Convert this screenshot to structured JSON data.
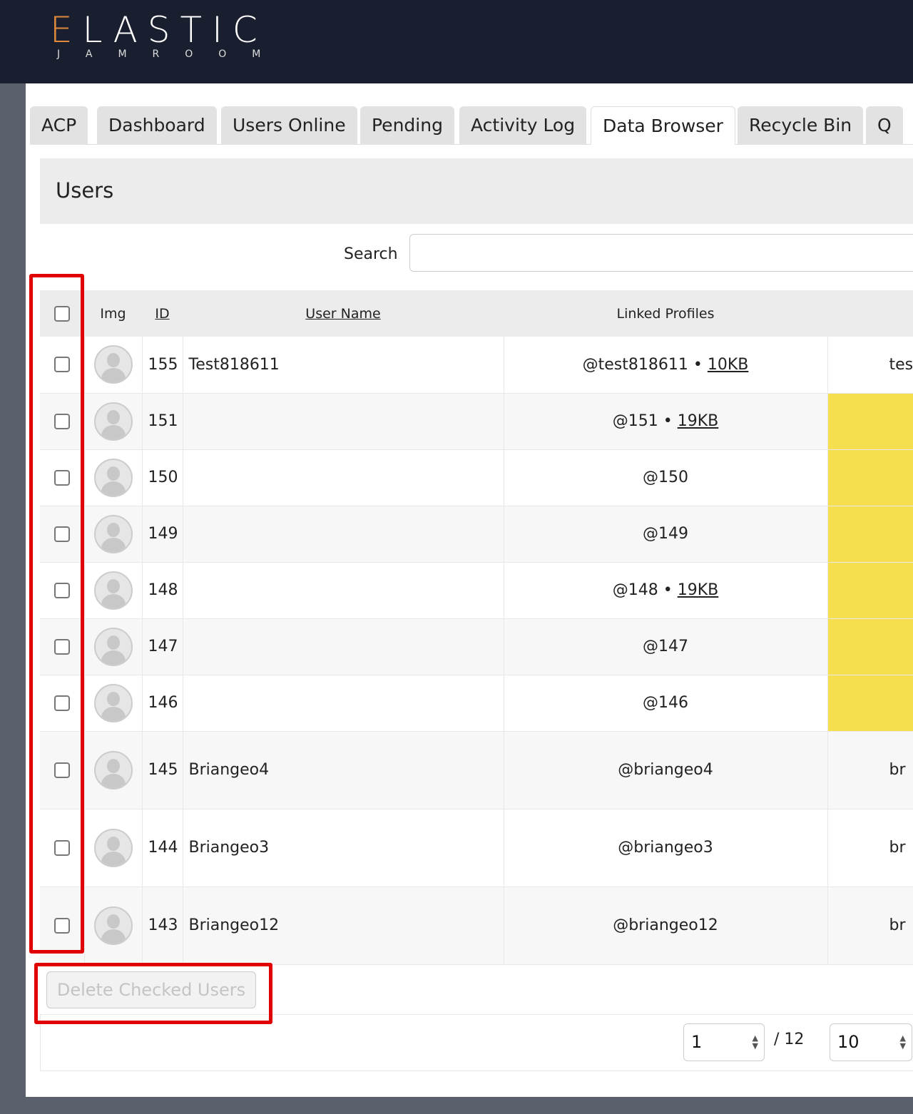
{
  "logo": {
    "main": "ELASTIC",
    "first_letter": "E",
    "rest": "LASTIC",
    "sub": "JAMROOM"
  },
  "tabs": [
    "ACP",
    "Dashboard",
    "Users Online",
    "Pending",
    "Activity Log",
    "Data Browser",
    "Recycle Bin",
    "Q"
  ],
  "active_tab": "Data Browser",
  "title": "Users",
  "search": {
    "label": "Search",
    "value": ""
  },
  "columns": {
    "img": "Img",
    "id": "ID",
    "user_name": "User Name",
    "linked_profiles": "Linked Profiles"
  },
  "rows": [
    {
      "id": "155",
      "name": "Test818611",
      "profile": "@test818611",
      "size": "10KB",
      "extra": "test",
      "highlight": false
    },
    {
      "id": "151",
      "name": "",
      "profile": "@151",
      "size": "19KB",
      "extra": "",
      "highlight": true
    },
    {
      "id": "150",
      "name": "",
      "profile": "@150",
      "size": "",
      "extra": "",
      "highlight": true
    },
    {
      "id": "149",
      "name": "",
      "profile": "@149",
      "size": "",
      "extra": "",
      "highlight": true
    },
    {
      "id": "148",
      "name": "",
      "profile": "@148",
      "size": "19KB",
      "extra": "",
      "highlight": true
    },
    {
      "id": "147",
      "name": "",
      "profile": "@147",
      "size": "",
      "extra": "",
      "highlight": true
    },
    {
      "id": "146",
      "name": "",
      "profile": "@146",
      "size": "",
      "extra": "",
      "highlight": true
    },
    {
      "id": "145",
      "name": "Briangeo4",
      "profile": "@briangeo4",
      "size": "",
      "extra": "br",
      "highlight": false
    },
    {
      "id": "144",
      "name": "Briangeo3",
      "profile": "@briangeo3",
      "size": "",
      "extra": "br",
      "highlight": false
    },
    {
      "id": "143",
      "name": "Briangeo12",
      "profile": "@briangeo12",
      "size": "",
      "extra": "br",
      "highlight": false
    }
  ],
  "separator": " • ",
  "delete_button": "Delete Checked Users",
  "pager": {
    "page": "1",
    "total": "/ 12",
    "per_page": "10"
  },
  "colors": {
    "header": "#1a1f30",
    "accent": "#e08a3c",
    "highlight": "#f6df4e",
    "annotation": "#e00000"
  }
}
